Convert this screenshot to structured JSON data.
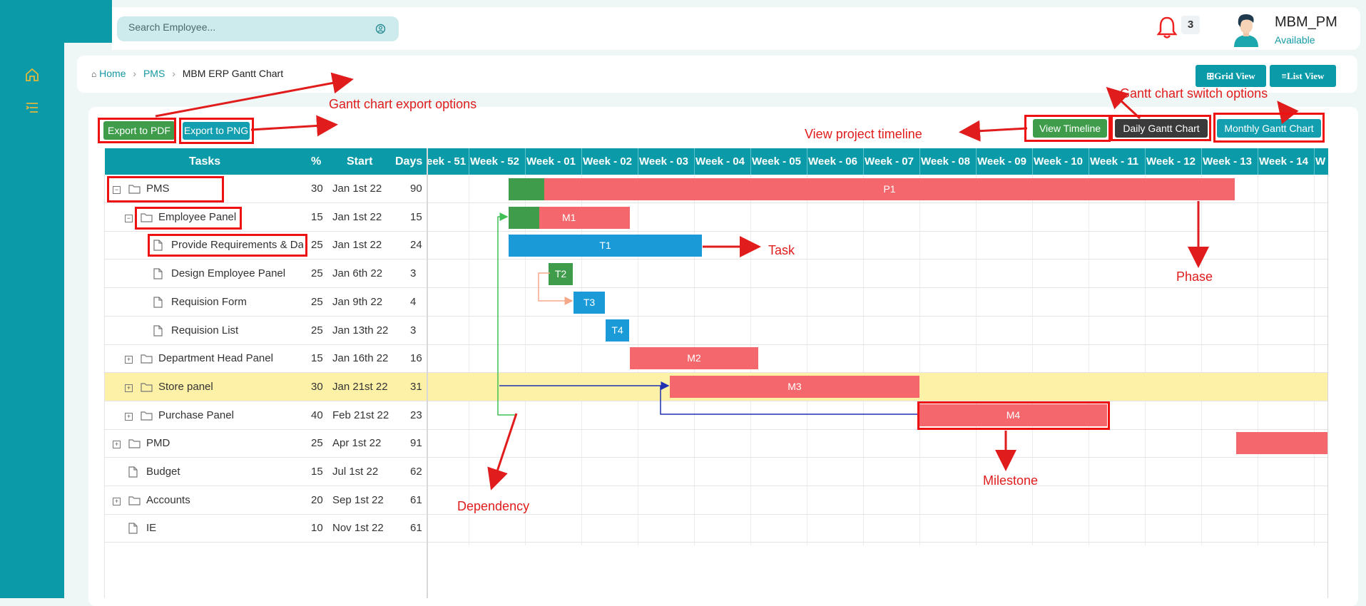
{
  "header": {
    "search_placeholder": "Search Employee...",
    "notification_count": "3",
    "user_name": "MBM_PM",
    "user_status": "Available"
  },
  "breadcrumb": {
    "home": "Home",
    "pms": "PMS",
    "current": "MBM ERP Gantt Chart"
  },
  "view_buttons": {
    "grid": "Grid View",
    "list": "List View"
  },
  "toolbar": {
    "export_pdf": "Export to PDF",
    "export_png": "Export to PNG",
    "view_timeline": "View Timeline",
    "daily_gantt": "Daily Gantt Chart",
    "monthly_gantt": "Monthly Gantt Chart"
  },
  "annotations": {
    "export": "Gantt chart export options",
    "switch": "Gantt chart switch options",
    "timeline": "View project timeline",
    "task": "Task",
    "phase": "Phase",
    "milestone": "Milestone",
    "dependency": "Dependency"
  },
  "grid": {
    "columns": [
      "Tasks",
      "%",
      "Start",
      "Days"
    ],
    "weeks": [
      "eek - 51",
      "Week - 52",
      "Week - 01",
      "Week - 02",
      "Week - 03",
      "Week - 04",
      "Week - 05",
      "Week - 06",
      "Week - 07",
      "Week - 08",
      "Week - 09",
      "Week - 10",
      "Week - 11",
      "Week - 12",
      "Week - 13",
      "Week - 14",
      "W"
    ],
    "rows": [
      {
        "name": "PMS",
        "pct": "30",
        "start": "Jan 1st 22",
        "days": "90"
      },
      {
        "name": "Employee Panel",
        "pct": "15",
        "start": "Jan 1st 22",
        "days": "15"
      },
      {
        "name": "Provide Requirements & Dat",
        "pct": "25",
        "start": "Jan 1st 22",
        "days": "24"
      },
      {
        "name": "Design Employee Panel",
        "pct": "25",
        "start": "Jan 6th 22",
        "days": "3"
      },
      {
        "name": "Requision Form",
        "pct": "25",
        "start": "Jan 9th 22",
        "days": "4"
      },
      {
        "name": "Requision List",
        "pct": "25",
        "start": "Jan 13th 22",
        "days": "3"
      },
      {
        "name": "Department Head Panel",
        "pct": "15",
        "start": "Jan 16th 22",
        "days": "16"
      },
      {
        "name": "Store panel",
        "pct": "30",
        "start": "Jan 21st 22",
        "days": "31"
      },
      {
        "name": "Purchase Panel",
        "pct": "40",
        "start": "Feb 21st 22",
        "days": "23"
      },
      {
        "name": "PMD",
        "pct": "25",
        "start": "Apr 1st 22",
        "days": "91"
      },
      {
        "name": "Budget",
        "pct": "15",
        "start": "Jul 1st 22",
        "days": "62"
      },
      {
        "name": "Accounts",
        "pct": "20",
        "start": "Sep 1st 22",
        "days": "61"
      },
      {
        "name": "IE",
        "pct": "10",
        "start": "Nov 1st 22",
        "days": "61"
      }
    ]
  },
  "bars": {
    "p1": "P1",
    "m1": "M1",
    "t1": "T1",
    "t2": "T2",
    "t3": "T3",
    "t4": "T4",
    "m2": "M2",
    "m3": "M3",
    "m4": "M4"
  },
  "colors": {
    "teal": "#0b9aa7",
    "green": "#3e9c4a",
    "red_bar": "#f4676c",
    "blue_bar": "#1a9ad6",
    "highlight": "#fdf1a8",
    "annotation": "#e01c1c"
  }
}
